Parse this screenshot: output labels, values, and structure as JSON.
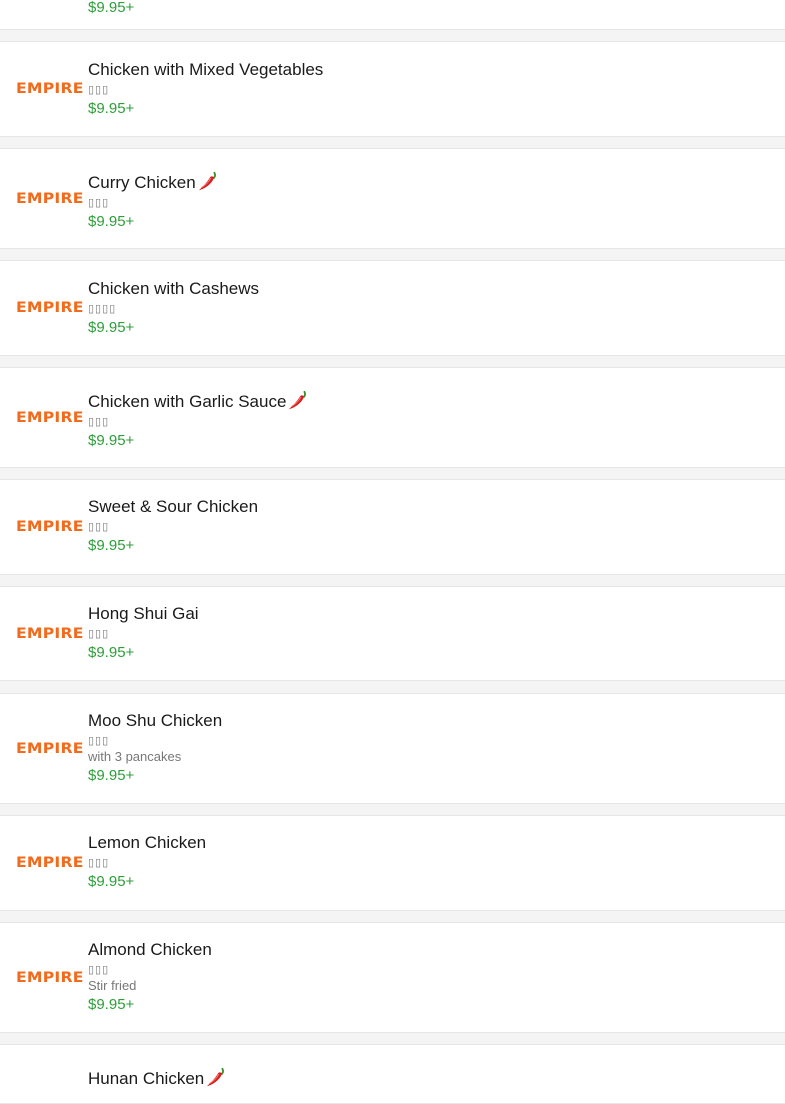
{
  "colors": {
    "accent_logo": "#f26a1b",
    "price": "#2e9e3a",
    "text": "#1a1a1a",
    "muted": "#7a7a7a",
    "background": "#f4f4f4",
    "card": "#ffffff",
    "pepper": "#d6201f"
  },
  "logo_text": "EMPIRE",
  "top_partial_price": "$9.95+",
  "items": [
    {
      "name": "Chicken with Mixed Vegetables",
      "chinese": "▯▯▯",
      "description": "",
      "price": "$9.95+",
      "spicy": false
    },
    {
      "name": "Curry Chicken",
      "chinese": "▯▯▯",
      "description": "",
      "price": "$9.95+",
      "spicy": true
    },
    {
      "name": "Chicken with Cashews",
      "chinese": "▯▯▯▯",
      "description": "",
      "price": "$9.95+",
      "spicy": false
    },
    {
      "name": "Chicken with Garlic Sauce",
      "chinese": "▯▯▯",
      "description": "",
      "price": "$9.95+",
      "spicy": true
    },
    {
      "name": "Sweet & Sour Chicken",
      "chinese": "▯▯▯",
      "description": "",
      "price": "$9.95+",
      "spicy": false
    },
    {
      "name": "Hong Shui Gai",
      "chinese": "▯▯▯",
      "description": "",
      "price": "$9.95+",
      "spicy": false
    },
    {
      "name": "Moo Shu Chicken",
      "chinese": "▯▯▯",
      "description": "with 3 pancakes",
      "price": "$9.95+",
      "spicy": false
    },
    {
      "name": "Lemon Chicken",
      "chinese": "▯▯▯",
      "description": "",
      "price": "$9.95+",
      "spicy": false
    },
    {
      "name": "Almond Chicken",
      "chinese": "▯▯▯",
      "description": "Stir fried",
      "price": "$9.95+",
      "spicy": false
    },
    {
      "name": "Hunan Chicken",
      "chinese": "",
      "description": "",
      "price": "",
      "spicy": true
    }
  ]
}
